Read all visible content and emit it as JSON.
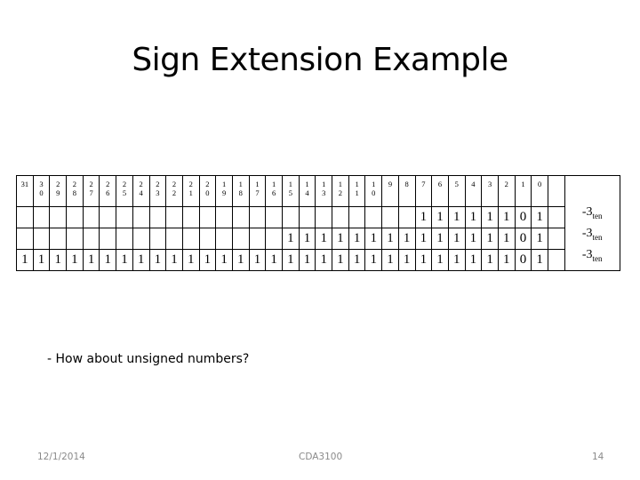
{
  "title": "Sign Extension Example",
  "bit_headers": [
    "31",
    "3\n0",
    "2\n9",
    "2\n8",
    "2\n7",
    "2\n6",
    "2\n5",
    "2\n4",
    "2\n3",
    "2\n2",
    "2\n1",
    "2\n0",
    "1\n9",
    "1\n8",
    "1\n7",
    "1\n6",
    "1\n5",
    "1\n4",
    "1\n3",
    "1\n2",
    "1\n1",
    "1\n0",
    "9",
    "8",
    "7",
    "6",
    "5",
    "4",
    "3",
    "2",
    "1",
    "0"
  ],
  "rows": [
    {
      "bits": [
        "",
        "",
        "",
        "",
        "",
        "",
        "",
        "",
        "",
        "",
        "",
        "",
        "",
        "",
        "",
        "",
        "",
        "",
        "",
        "",
        "",
        "",
        "",
        "",
        "1",
        "1",
        "1",
        "1",
        "1",
        "1",
        "0",
        "1"
      ],
      "value": "-3",
      "value_sub": "ten"
    },
    {
      "bits": [
        "",
        "",
        "",
        "",
        "",
        "",
        "",
        "",
        "",
        "",
        "",
        "",
        "",
        "",
        "",
        "",
        "1",
        "1",
        "1",
        "1",
        "1",
        "1",
        "1",
        "1",
        "1",
        "1",
        "1",
        "1",
        "1",
        "1",
        "0",
        "1"
      ],
      "value": "-3",
      "value_sub": "ten"
    },
    {
      "bits": [
        "1",
        "1",
        "1",
        "1",
        "1",
        "1",
        "1",
        "1",
        "1",
        "1",
        "1",
        "1",
        "1",
        "1",
        "1",
        "1",
        "1",
        "1",
        "1",
        "1",
        "1",
        "1",
        "1",
        "1",
        "1",
        "1",
        "1",
        "1",
        "1",
        "1",
        "0",
        "1"
      ],
      "value": "-3",
      "value_sub": "ten"
    }
  ],
  "note": "- How about unsigned numbers?",
  "footer": {
    "date": "12/1/2014",
    "course": "CDA3100",
    "page": "14"
  }
}
